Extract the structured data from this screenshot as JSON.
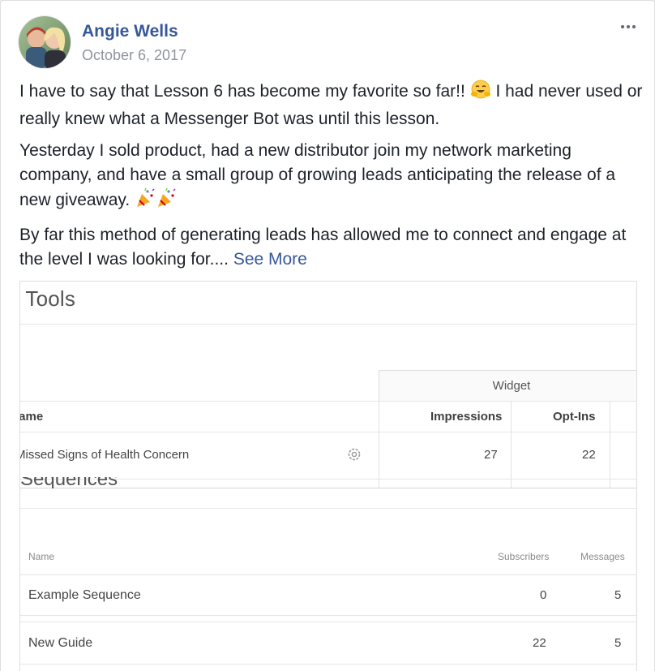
{
  "post": {
    "author": "Angie Wells",
    "date": "October 6, 2017",
    "paragraphs": {
      "p1_a": "I have to say that Lesson 6 has become my favorite so far!! ",
      "p1_b": " I had never used or really knew what a Messenger Bot was until this lesson.",
      "p2": "Yesterday I sold product, had a new distributor join my network marketing company, and have a small group of growing leads anticipating the release of a new giveaway. ",
      "p3": "By far this method of generating leads has allowed me to connect and engage at the level I was looking for.... "
    },
    "see_more": "See More",
    "icons": {
      "more": "more-options-icon",
      "emoji_hug": "hugging-face-emoji",
      "emoji_party": "party-popper-emoji"
    }
  },
  "screenshot": {
    "title": "ı Tools",
    "widget_group": "Widget",
    "table1": {
      "headers": {
        "name": "lame",
        "impressions": "Impressions",
        "optins": "Opt-Ins"
      },
      "row": {
        "name": "Missed Signs of Health Concern",
        "impressions": "27",
        "optins": "22"
      }
    },
    "section2_title": "Sequences",
    "table2": {
      "headers": {
        "name": "Name",
        "subscribers": "Subscribers",
        "messages": "Messages"
      },
      "rows": [
        {
          "name": "Example Sequence",
          "subscribers": "0",
          "messages": "5"
        },
        {
          "name": "New Guide",
          "subscribers": "22",
          "messages": "5"
        }
      ]
    }
  },
  "colors": {
    "link": "#365899",
    "text": "#1d2129",
    "meta": "#90949c"
  }
}
